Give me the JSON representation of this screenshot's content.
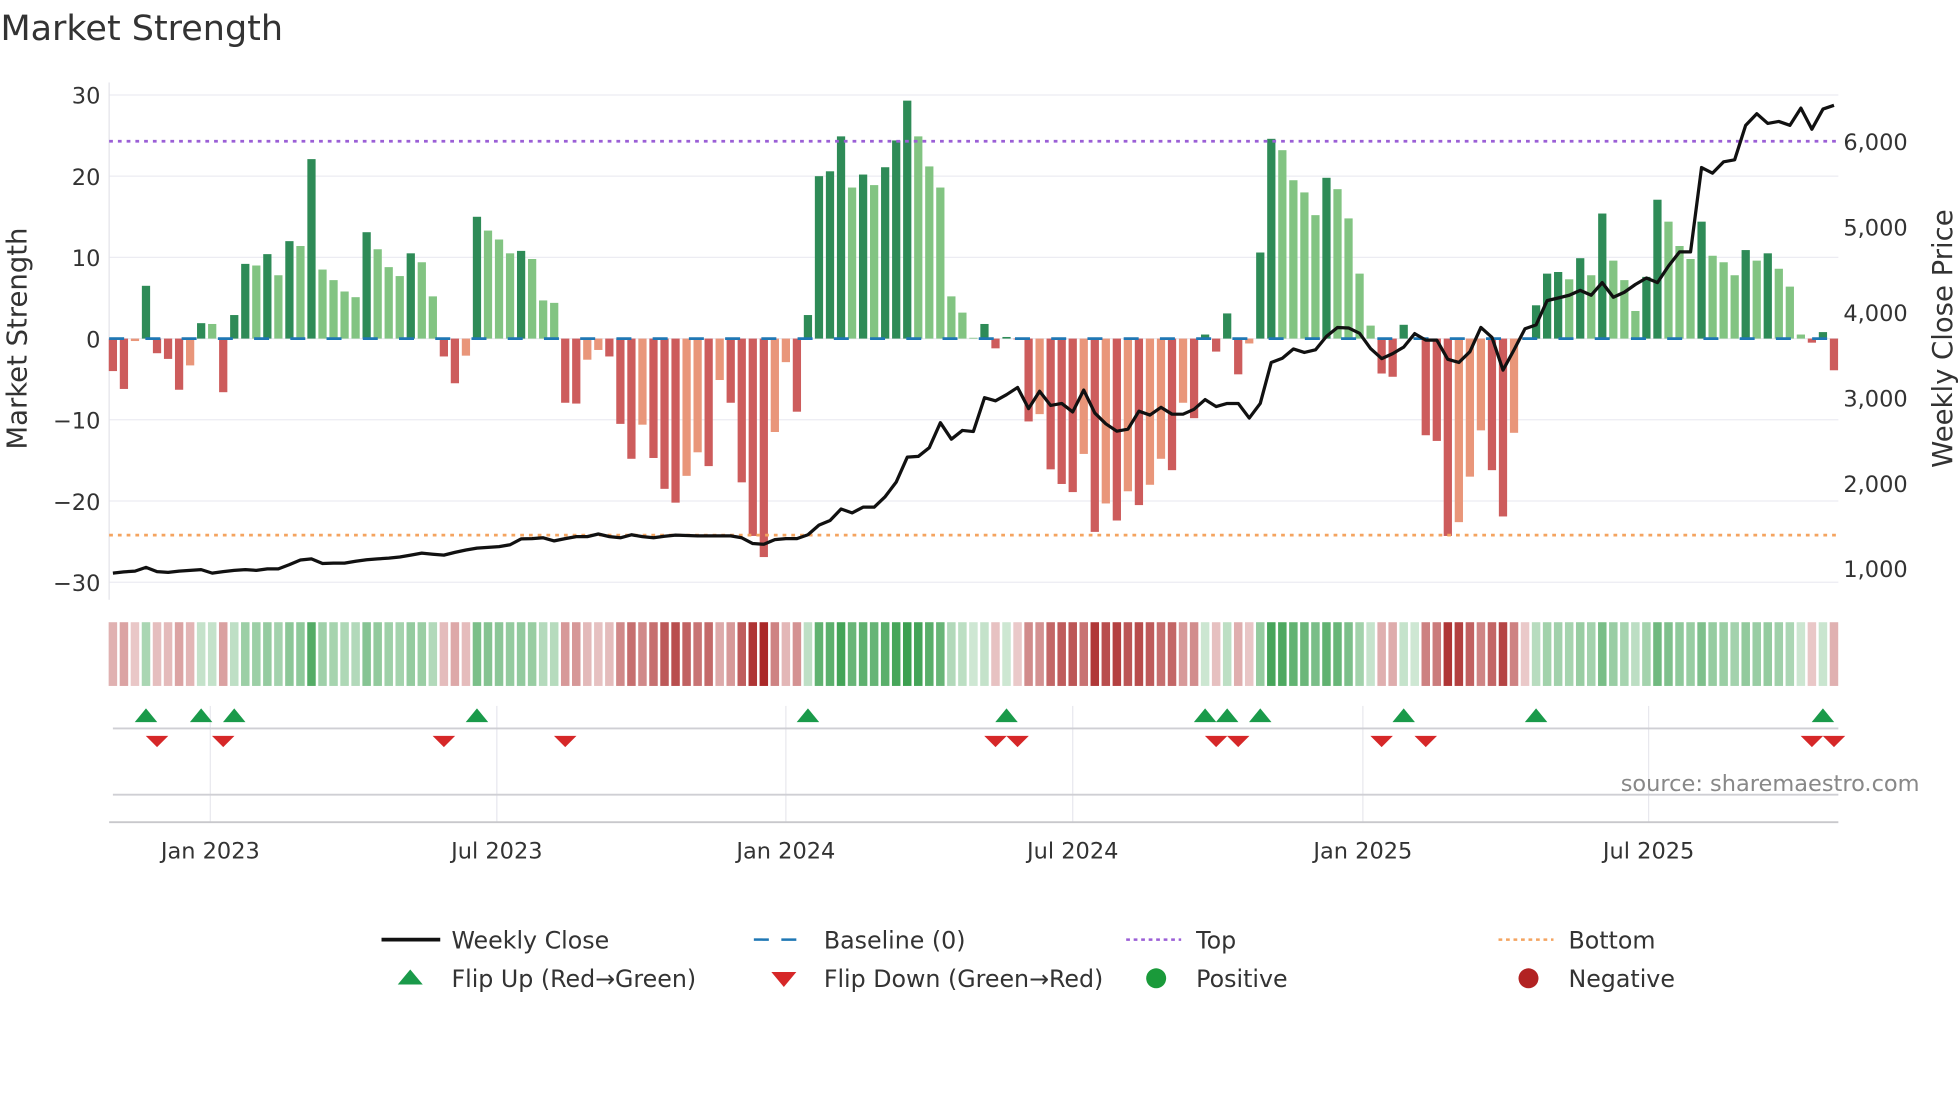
{
  "chart_data": {
    "type": "bar",
    "title": "Market Strength",
    "ylabel": "Market Strength",
    "y2label": "Weekly Close Price",
    "ylim": [
      -30,
      30
    ],
    "y2lim": [
      1000,
      6000
    ],
    "yticks": [
      "30",
      "20",
      "10",
      "0",
      "−10",
      "−20",
      "−30"
    ],
    "yticks_values": [
      30,
      20,
      10,
      0,
      -10,
      -20,
      -30
    ],
    "y2ticks": [
      "6,000",
      "5,000",
      "4,000",
      "3,000",
      "2,000",
      "1,000"
    ],
    "y2ticks_values": [
      6000,
      5000,
      4000,
      3000,
      2000,
      1000
    ],
    "xticks": [
      {
        "label": "Jan 2023",
        "week_index": 8.83
      },
      {
        "label": "Jul 2023",
        "week_index": 34.8
      },
      {
        "label": "Jan 2024",
        "week_index": 61.0
      },
      {
        "label": "Jul 2024",
        "week_index": 87.0
      },
      {
        "label": "Jan 2025",
        "week_index": 113.3
      },
      {
        "label": "Jul 2025",
        "week_index": 139.2
      }
    ],
    "top_level": 24.3,
    "bottom_level": -24.2,
    "strength": [
      -4,
      -6.2,
      -0.3,
      6.5,
      -1.8,
      -2.5,
      -6.3,
      -3.3,
      1.9,
      1.8,
      -6.6,
      2.9,
      9.2,
      9,
      10.4,
      7.8,
      12,
      11.4,
      22.1,
      8.5,
      7.2,
      5.8,
      5.1,
      13.1,
      11,
      8.8,
      7.7,
      10.5,
      9.4,
      5.2,
      -2.2,
      -5.5,
      -2.1,
      15,
      13.3,
      12.2,
      10.5,
      10.8,
      9.8,
      4.7,
      4.4,
      -7.9,
      -8,
      -2.6,
      -1.4,
      -2.2,
      -10.5,
      -14.8,
      -10.6,
      -14.7,
      -18.5,
      -20.2,
      -16.9,
      -14,
      -15.7,
      -5.1,
      -7.9,
      -17.7,
      -24.3,
      -26.9,
      -11.5,
      -2.9,
      -9,
      2.9,
      20,
      20.6,
      24.9,
      18.6,
      20.2,
      18.9,
      21.1,
      24.4,
      29.3,
      24.9,
      21.2,
      18.6,
      5.2,
      3.2,
      0.1,
      1.8,
      -1.2,
      0.2,
      -0.1,
      -10.2,
      -9.3,
      -16.1,
      -17.9,
      -18.9,
      -14.2,
      -23.8,
      -20.3,
      -22.4,
      -18.8,
      -20.5,
      -18,
      -14.8,
      -16.2,
      -7.9,
      -9.8,
      0.5,
      -1.6,
      3.1,
      -4.4,
      -0.6,
      10.6,
      24.6,
      23.2,
      19.5,
      18,
      15.2,
      19.8,
      18.4,
      14.8,
      8,
      1.6,
      -4.3,
      -4.7,
      1.7,
      0.1,
      -11.9,
      -12.6,
      -24.3,
      -22.6,
      -17,
      -11.3,
      -16.2,
      -21.9,
      -11.6,
      -0.1,
      4.1,
      8,
      8.2,
      7.3,
      9.9,
      7.8,
      15.4,
      9.6,
      7.2,
      3.4,
      7.6,
      17.1,
      14.4,
      11.4,
      9.8,
      14.4,
      10.2,
      9.4,
      7.8,
      10.9,
      9.6,
      10.5,
      8.6,
      6.4,
      0.5,
      -0.5,
      0.8,
      -3.9
    ],
    "weekly_close": [
      946,
      960,
      969,
      1013,
      964,
      955,
      969,
      978,
      987,
      946,
      964,
      978,
      987,
      978,
      996,
      996,
      1045,
      1099,
      1112,
      1058,
      1063,
      1063,
      1085,
      1103,
      1112,
      1121,
      1135,
      1157,
      1180,
      1166,
      1157,
      1189,
      1216,
      1238,
      1247,
      1256,
      1278,
      1346,
      1350,
      1359,
      1323,
      1350,
      1373,
      1373,
      1404,
      1373,
      1359,
      1395,
      1373,
      1359,
      1377,
      1391,
      1386,
      1382,
      1382,
      1382,
      1382,
      1359,
      1292,
      1283,
      1337,
      1350,
      1350,
      1395,
      1507,
      1561,
      1696,
      1651,
      1718,
      1718,
      1840,
      2010,
      2302,
      2311,
      2414,
      2706,
      2513,
      2616,
      2603,
      2998,
      2962,
      3034,
      3119,
      2872,
      3074,
      2908,
      2931,
      2832,
      3088,
      2818,
      2693,
      2607,
      2630,
      2841,
      2796,
      2886,
      2805,
      2805,
      2863,
      2976,
      2895,
      2931,
      2931,
      2760,
      2931,
      3411,
      3461,
      3568,
      3528,
      3559,
      3716,
      3820,
      3815,
      3752,
      3573,
      3456,
      3514,
      3591,
      3748,
      3672,
      3672,
      3447,
      3411,
      3537,
      3820,
      3703,
      3321,
      3559,
      3806,
      3851,
      4134,
      4165,
      4197,
      4255,
      4197,
      4345,
      4174,
      4233,
      4323,
      4399,
      4345,
      4538,
      4704,
      4704,
      5692,
      5625,
      5759,
      5782,
      6186,
      6321,
      6208,
      6231,
      6186,
      6388,
      6141,
      6375,
      6419
    ],
    "legend": {
      "weekly_close": "Weekly Close",
      "baseline": "Baseline (0)",
      "top": "Top",
      "bottom": "Bottom",
      "flip_up": "Flip Up (Red→Green)",
      "flip_down": "Flip Down (Green→Red)",
      "positive": "Positive",
      "negative": "Negative"
    },
    "legend_placement": "bottom",
    "source": "source: sharemaestro.com",
    "colors": {
      "pos_strong": "#2e8b57",
      "pos_weak": "#82c482",
      "neg_strong": "#cd5c5c",
      "neg_weak": "#e9967a",
      "baseline": "#1f77b4",
      "top": "#9b5fd6",
      "bottom": "#f4a460",
      "flip_up": "#1a9a4a",
      "flip_down": "#d62728",
      "positive": "#1a9a3a",
      "negative": "#b22222"
    }
  }
}
